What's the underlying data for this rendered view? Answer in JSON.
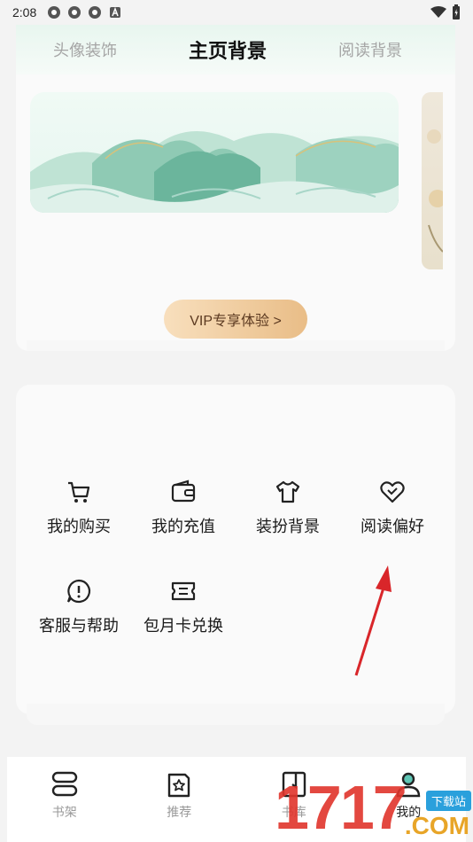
{
  "status_bar": {
    "time": "2:08"
  },
  "decor": {
    "tabs": [
      "头像装饰",
      "主页背景",
      "阅读背景"
    ],
    "active_tab": "主页背景",
    "vip_button": "VIP专享体验 >"
  },
  "menu": {
    "items": [
      {
        "label": "我的购买",
        "icon": "cart-icon"
      },
      {
        "label": "我的充值",
        "icon": "wallet-icon"
      },
      {
        "label": "装扮背景",
        "icon": "tshirt-icon"
      },
      {
        "label": "阅读偏好",
        "icon": "heart-icon"
      },
      {
        "label": "客服与帮助",
        "icon": "chat-alert-icon"
      },
      {
        "label": "包月卡兑换",
        "icon": "ticket-icon"
      }
    ]
  },
  "nav": {
    "items": [
      {
        "label": "书架",
        "icon": "bookshelf-icon"
      },
      {
        "label": "推荐",
        "icon": "star-book-icon"
      },
      {
        "label": "书库",
        "icon": "library-icon"
      },
      {
        "label": "我的",
        "icon": "user-icon"
      }
    ],
    "active": "我的"
  },
  "watermark": {
    "digits": "1717",
    "tag": "下载站",
    "suffix": ".COM"
  },
  "colors": {
    "accent_red": "#e0352c",
    "vip_gold": "#e9bd87"
  }
}
